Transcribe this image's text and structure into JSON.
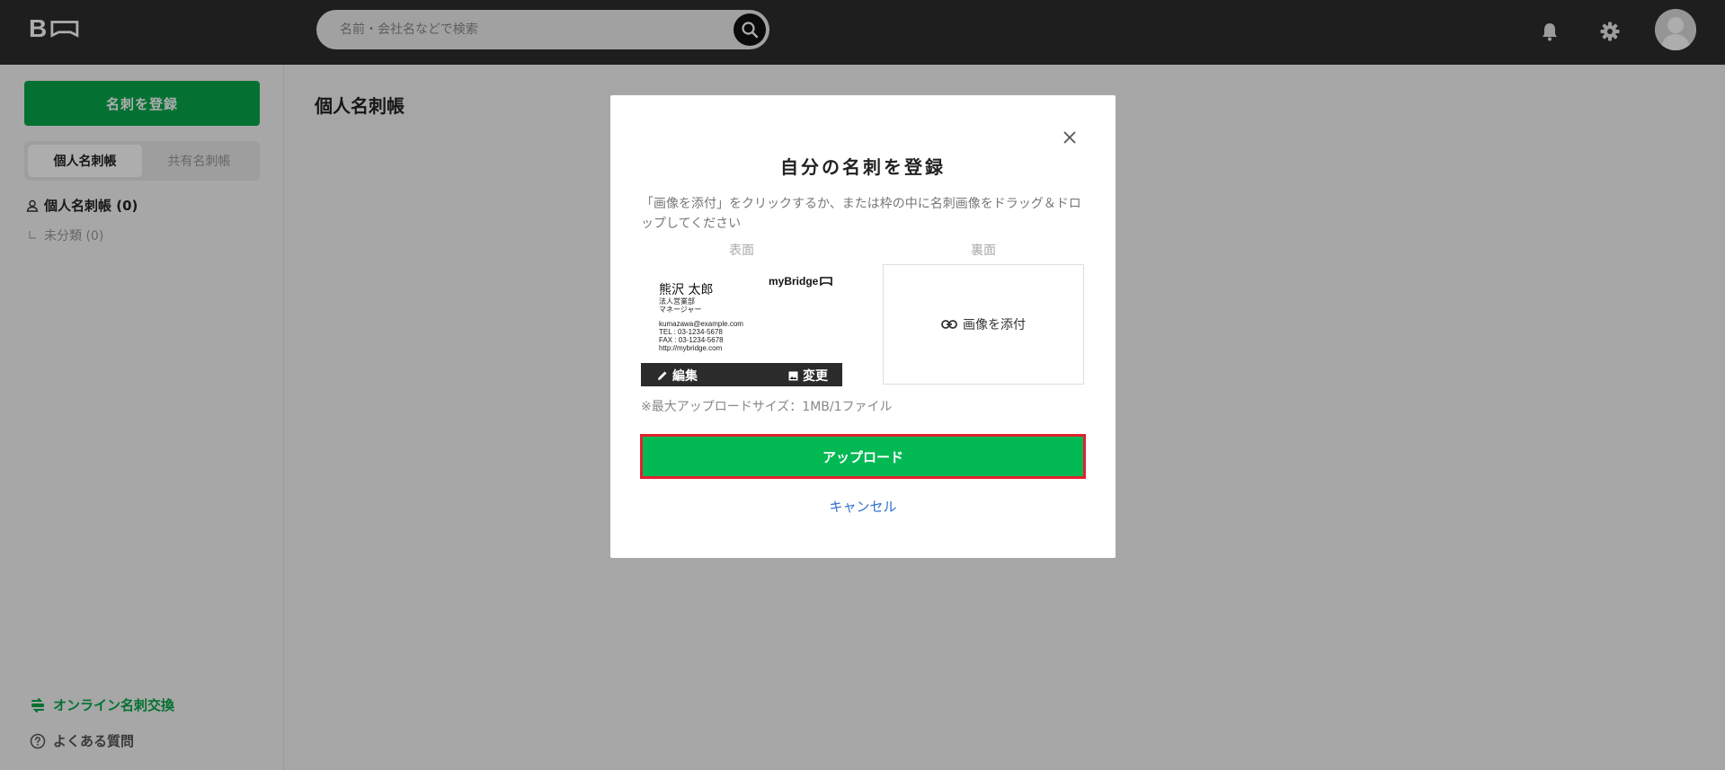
{
  "header": {
    "search_placeholder": "名前・会社名などで検索"
  },
  "sidebar": {
    "register_button": "名刺を登録",
    "tabs": [
      {
        "label": "個人名刺帳",
        "active": true
      },
      {
        "label": "共有名刺帳",
        "active": false
      }
    ],
    "tree_root": "個人名刺帳 (0)",
    "tree_child": "未分類 (0)",
    "online_exchange": "オンライン名刺交換",
    "faq": "よくある質問"
  },
  "main": {
    "title": "個人名刺帳"
  },
  "modal": {
    "title": "自分の名刺を登録",
    "description": "「画像を添付」をクリックするか、または枠の中に名刺画像をドラッグ＆ドロップしてください",
    "front_label": "表面",
    "back_label": "裏面",
    "card": {
      "name": "熊沢 太郎",
      "department": "法人営業部",
      "role": "マネージャー",
      "email": "kumazawa@example.com",
      "tel": "TEL : 03-1234-5678",
      "fax": "FAX : 03-1234-5678",
      "url": "http://mybridge.com",
      "brand": "myBridge"
    },
    "edit_label": "編集",
    "change_label": "変更",
    "attach_label": "画像を添付",
    "size_note": "※最大アップロードサイズ：1MB/1ファイル",
    "upload_button": "アップロード",
    "cancel_link": "キャンセル"
  },
  "colors": {
    "green_primary": "#06a74a",
    "green_upload": "#02b954",
    "highlight_border": "#e3212e",
    "link_blue": "#2f6fd0",
    "topbar": "#2d2d2d"
  }
}
